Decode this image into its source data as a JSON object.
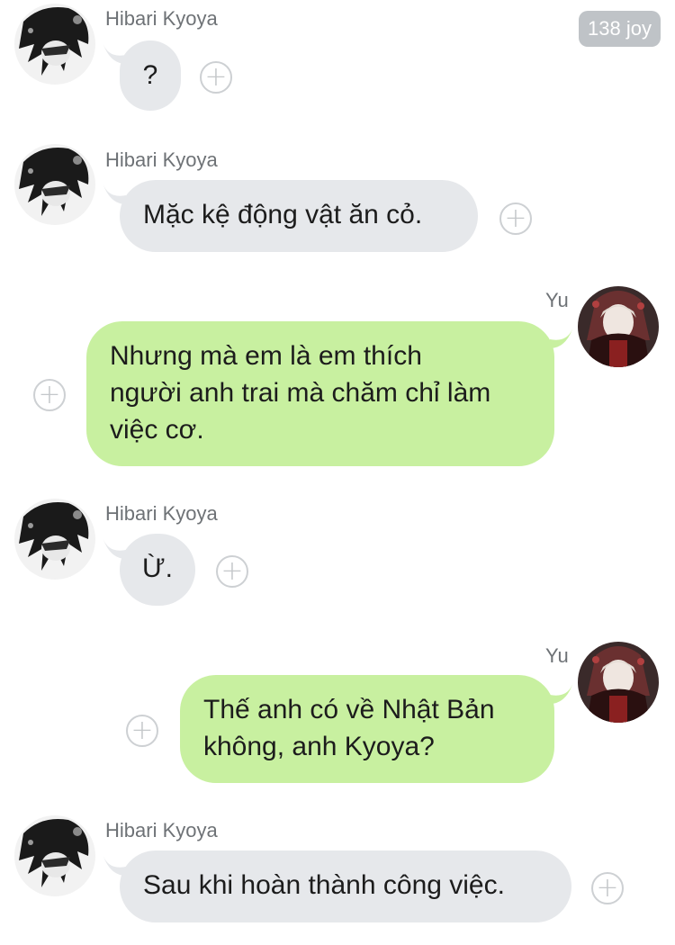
{
  "header": {
    "badge": "138 joy"
  },
  "add_glyph": "+",
  "messages": [
    {
      "sender": "Hibari Kyoya",
      "text": "?"
    },
    {
      "sender": "Hibari Kyoya",
      "text": "Mặc kệ động vật ăn cỏ."
    },
    {
      "sender": "Yu",
      "lines": [
        "Nhưng mà em là em thích",
        "người anh trai mà chăm chỉ làm",
        "việc cơ."
      ]
    },
    {
      "sender": "Hibari Kyoya",
      "text": "Ừ."
    },
    {
      "sender": "Yu",
      "lines": [
        "Thế anh có về Nhật Bản",
        "không, anh Kyoya?"
      ]
    },
    {
      "sender": "Hibari Kyoya",
      "text": "Sau khi hoàn thành công việc."
    }
  ],
  "colors": {
    "incoming_bubble": "#e6e8eb",
    "outgoing_bubble": "#c8f0a0",
    "badge": "#bfc3c7"
  }
}
